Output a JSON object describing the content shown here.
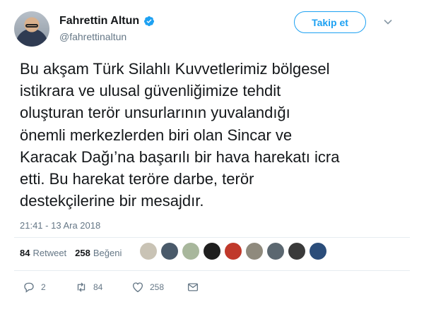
{
  "author": {
    "name": "Fahrettin Altun",
    "handle": "@fahrettinaltun",
    "verified_icon": "verified-badge-icon"
  },
  "follow_button": {
    "label": "Takip et"
  },
  "tweet": {
    "text": "Bu akşam Türk Silahlı Kuvvetlerimiz bölgesel\nistikrara ve ulusal güvenliğimize tehdit\noluşturan terör unsurlarının yuvalandığı\nönemli merkezlerden biri olan Sincar ve\nKaracak Dağı’na başarılı bir hava harekatı icra\netti. Bu harekat teröre darbe, terör\ndestekçilerine bir mesajdır.",
    "timestamp": "21:41 - 13 Ara 2018"
  },
  "stats": {
    "retweets_count": "84",
    "retweets_label": "Retweet",
    "likes_count": "258",
    "likes_label": "Beğeni"
  },
  "liker_avatars": [
    "#c9c3b5",
    "#4a5a6a",
    "#a8b79c",
    "#1f1f1f",
    "#c0392b",
    "#8f8a7d",
    "#5b6770",
    "#3a3a3a",
    "#2b4d7a"
  ],
  "actions": {
    "reply_count": "2",
    "retweet_count": "84",
    "like_count": "258"
  },
  "colors": {
    "accent": "#1da1f2",
    "text": "#14171a",
    "secondary": "#657786"
  }
}
